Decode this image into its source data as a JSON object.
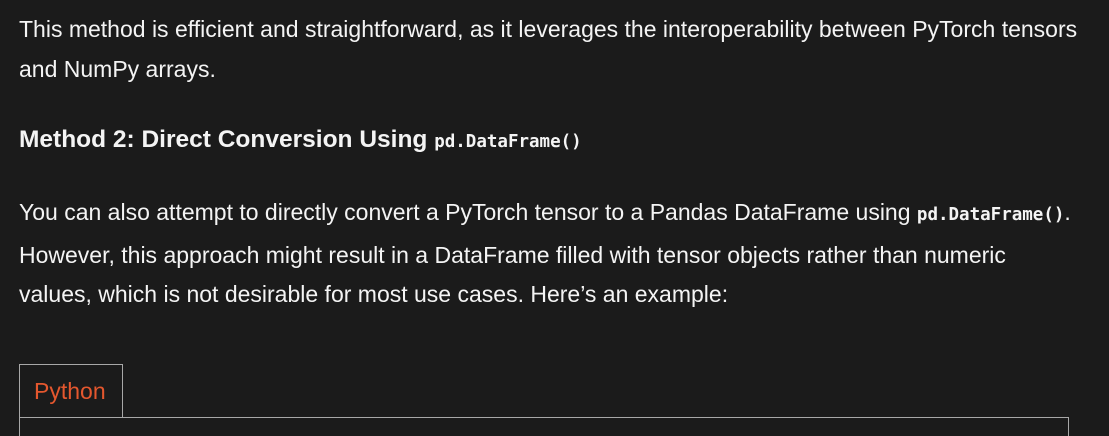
{
  "intro": {
    "text": "This method is efficient and straightforward, as it leverages the interoperability between PyTorch tensors and NumPy arrays."
  },
  "method2": {
    "heading": "Method 2: Direct Conversion Using ",
    "heading_code": "pd.DataFrame()"
  },
  "body": {
    "line_start": "You can also attempt to directly convert a PyTorch tensor to a Pandas DataFrame using ",
    "inline_code": "pd.DataFrame()",
    "line_end": ". However, this approach might result in a DataFrame filled with tensor objects rather than numeric values, which is not desirable for most use cases. Here’s an example:"
  },
  "code_block": {
    "tab_label": "Python",
    "accent_color": "#e4572e"
  }
}
